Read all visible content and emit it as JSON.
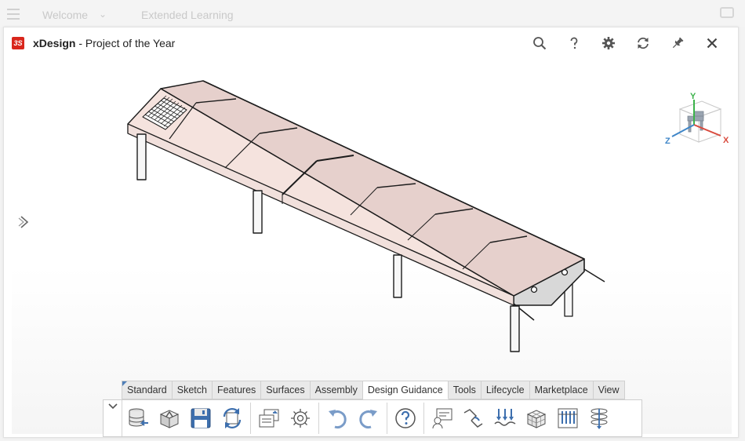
{
  "background": {
    "menu_label": "Welcome",
    "extended_label": "Extended Learning"
  },
  "window": {
    "app_name": "xDesign",
    "project": " - Project of the Year",
    "logo_text": "3S"
  },
  "triad": {
    "x": "X",
    "y": "Y",
    "z": "Z"
  },
  "tabs": [
    "Standard",
    "Sketch",
    "Features",
    "Surfaces",
    "Assembly",
    "Design Guidance",
    "Tools",
    "Lifecycle",
    "Marketplace",
    "View"
  ],
  "active_tab": "Design Guidance",
  "tools": [
    {
      "name": "database-import-icon"
    },
    {
      "name": "open-part-icon"
    },
    {
      "name": "save-icon"
    },
    {
      "name": "refresh-model-icon"
    },
    {
      "name": "feature-manager-icon"
    },
    {
      "name": "settings-gear-icon"
    },
    {
      "name": "undo-icon"
    },
    {
      "name": "redo-icon"
    },
    {
      "name": "help-icon"
    },
    {
      "name": "design-review-icon"
    },
    {
      "name": "routing-icon"
    },
    {
      "name": "loads-icon"
    },
    {
      "name": "mesh-cube-icon"
    },
    {
      "name": "results-bars-icon"
    },
    {
      "name": "stacked-layers-icon"
    }
  ],
  "colors": {
    "brand": "#d9261c",
    "panel_fill": "#f3dfda",
    "panel_dark": "#e8d3cf",
    "accent_blue": "#3d6fae"
  }
}
